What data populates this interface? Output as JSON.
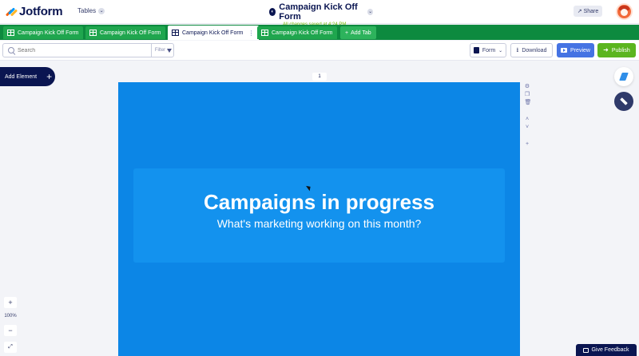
{
  "topbar": {
    "logo_text": "Jotform",
    "tables_menu": "Tables",
    "form_title": "Campaign Kick Off Form",
    "save_status": "All changes saved at 4:24 PM",
    "share_label": "Share"
  },
  "tabs": [
    {
      "label": "Campaign Kick Off Form",
      "active": false
    },
    {
      "label": "Campaign Kick Off Form",
      "active": false
    },
    {
      "label": "Campaign Kick Off Form",
      "active": true
    },
    {
      "label": "Campaign Kick Off Form",
      "active": false
    }
  ],
  "add_tab_label": "Add Tab",
  "toolbar": {
    "search_placeholder": "Search",
    "filter_label": "Filter",
    "form_label": "Form",
    "download_label": "Download",
    "preview_label": "Preview",
    "publish_label": "Publish"
  },
  "canvas": {
    "add_element_label": "Add Element",
    "page_number": "1",
    "heading": "Campaigns in progress",
    "subheading": "What's marketing working on this month?",
    "zoom_level": "100%",
    "feedback_label": "Give Feedback"
  },
  "colors": {
    "brand_navy": "#0a1551",
    "tab_green": "#0d8a3f",
    "form_background": "#0c86e6",
    "header_card": "#1392ee",
    "preview_blue": "#4573e3",
    "publish_green": "#5bb51f",
    "saved_green": "#78bb07"
  },
  "icons": [
    "jotform-logo-icon",
    "chevron-down-icon",
    "form-status-icon",
    "share-icon",
    "table-icon",
    "plus-icon",
    "search-icon",
    "funnel-icon",
    "form-icon",
    "download-icon",
    "preview-icon",
    "publish-arrow-icon",
    "gear-icon",
    "copy-icon",
    "trash-icon",
    "chevron-up-icon",
    "bolt-icon",
    "layers-icon",
    "chat-icon"
  ]
}
